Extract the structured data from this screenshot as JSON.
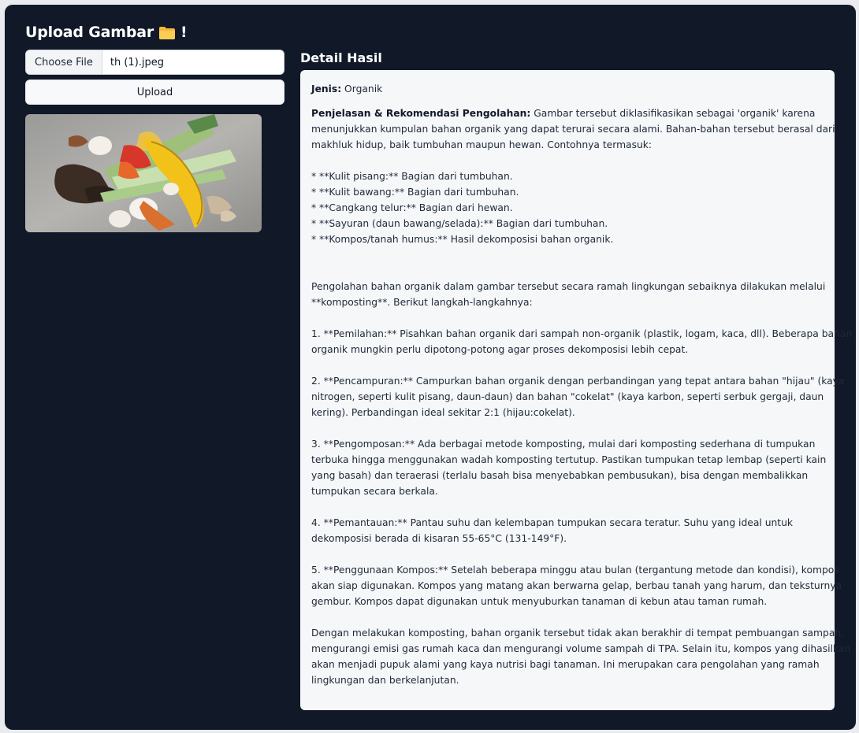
{
  "header": {
    "title": "Upload Gambar",
    "emoji_suffix": "!"
  },
  "file_input": {
    "button_label": "Choose File",
    "file_name": "th (1).jpeg"
  },
  "upload_button": {
    "label": "Upload"
  },
  "detail": {
    "title": "Detail Hasil",
    "jenis_label": "Jenis:",
    "jenis_value": "Organik",
    "penjelasan_label": "Penjelasan & Rekomendasi Pengolahan:",
    "lines": [
      " Gambar tersebut diklasifikasikan sebagai 'organik' karena",
      "menunjukkan kumpulan bahan organik yang dapat terurai secara alami. Bahan-bahan tersebut berasal dari",
      "makhluk hidup, baik tumbuhan maupun hewan. Contohnya termasuk:",
      "",
      "* **Kulit pisang:** Bagian dari tumbuhan.",
      "* **Kulit bawang:** Bagian dari tumbuhan.",
      "* **Cangkang telur:** Bagian dari hewan.",
      "* **Sayuran (daun bawang/selada):** Bagian dari tumbuhan.",
      "* **Kompos/tanah humus:** Hasil dekomposisi bahan organik.",
      "",
      "",
      "Pengolahan bahan organik dalam gambar tersebut secara ramah lingkungan sebaiknya dilakukan melalui",
      "**komposting**. Berikut langkah-langkahnya:",
      "",
      "1. **Pemilahan:** Pisahkan bahan organik dari sampah non-organik (plastik, logam, kaca, dll). Beberapa bahan",
      "organik mungkin perlu dipotong-potong agar proses dekomposisi lebih cepat.",
      "",
      "2. **Pencampuran:** Campurkan bahan organik dengan perbandingan yang tepat antara bahan \"hijau\" (kaya",
      "nitrogen, seperti kulit pisang, daun-daun) dan bahan \"cokelat\" (kaya karbon, seperti serbuk gergaji, daun",
      "kering). Perbandingan ideal sekitar 2:1 (hijau:cokelat).",
      "",
      "3. **Pengomposan:** Ada berbagai metode komposting, mulai dari komposting sederhana di tumpukan",
      "terbuka hingga menggunakan wadah komposting tertutup. Pastikan tumpukan tetap lembap (seperti kain",
      "yang basah) dan teraerasi (terlalu basah bisa menyebabkan pembusukan), bisa dengan membalikkan",
      "tumpukan secara berkala.",
      "",
      "4. **Pemantauan:** Pantau suhu dan kelembapan tumpukan secara teratur. Suhu yang ideal untuk",
      "dekomposisi berada di kisaran 55-65°C (131-149°F).",
      "",
      "5. **Penggunaan Kompos:** Setelah beberapa minggu atau bulan (tergantung metode dan kondisi), kompos",
      "akan siap digunakan. Kompos yang matang akan berwarna gelap, berbau tanah yang harum, dan teksturnya",
      "gembur. Kompos dapat digunakan untuk menyuburkan tanaman di kebun atau taman rumah.",
      "",
      "Dengan melakukan komposting, bahan organik tersebut tidak akan berakhir di tempat pembuangan sampah,",
      "mengurangi emisi gas rumah kaca dan mengurangi volume sampah di TPA. Selain itu, kompos yang dihasilkan",
      "akan menjadi pupuk alami yang kaya nutrisi bagi tanaman. Ini merupakan cara pengolahan yang ramah",
      "lingkungan dan berkelanjutan."
    ]
  },
  "icons": {
    "header_icon": "folder-icon"
  },
  "colors": {
    "background": "#111827",
    "panel": "#f5f7f9",
    "heading": "#ffffff"
  }
}
